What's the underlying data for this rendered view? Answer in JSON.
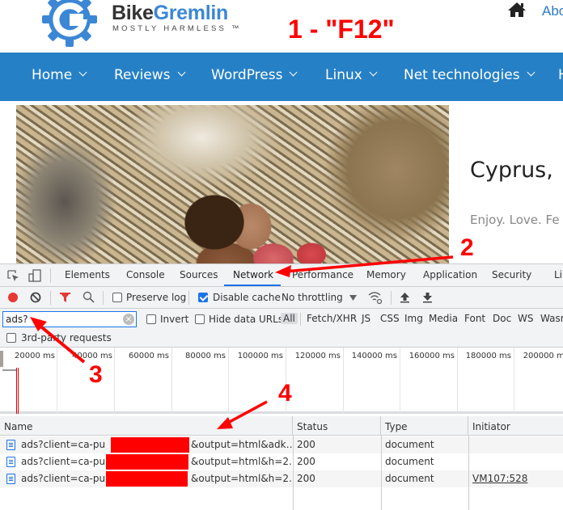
{
  "site": {
    "logo_brand_part1": "Bike",
    "logo_brand_part2": "Gremlin",
    "logo_tagline": "MOSTLY HARMLESS ™",
    "top_link": "About",
    "nav": [
      {
        "label": "Home"
      },
      {
        "label": "Reviews"
      },
      {
        "label": "WordPress"
      },
      {
        "label": "Linux"
      },
      {
        "label": "Net technologies"
      },
      {
        "label": "H"
      }
    ],
    "post_title": "Cyprus,",
    "post_tagline": "Enjoy. Love. Fe"
  },
  "annotations": {
    "step1": "1 - \"F12\"",
    "step2": "2",
    "step3": "3",
    "step4": "4",
    "color": "#ff0000"
  },
  "devtools": {
    "tabs": [
      {
        "label": "Elements"
      },
      {
        "label": "Console"
      },
      {
        "label": "Sources"
      },
      {
        "label": "Network",
        "active": true
      },
      {
        "label": "Performance"
      },
      {
        "label": "Memory"
      },
      {
        "label": "Application"
      },
      {
        "label": "Security"
      },
      {
        "label": "Li"
      }
    ],
    "toolbar": {
      "preserve_log": {
        "label": "Preserve log",
        "checked": false
      },
      "disable_cache": {
        "label": "Disable cache",
        "checked": true
      },
      "throttling": "No throttling"
    },
    "filter": {
      "value": "ads?",
      "invert": {
        "label": "Invert",
        "checked": false
      },
      "hide_data_urls": {
        "label": "Hide data URLs",
        "checked": false
      },
      "types": [
        "All",
        "Fetch/XHR",
        "JS",
        "CSS",
        "Img",
        "Media",
        "Font",
        "Doc",
        "WS",
        "Wasm"
      ],
      "active_type": "All",
      "third_party": {
        "label": "3rd-party requests",
        "checked": false
      }
    },
    "timeline_ticks": [
      "20000 ms",
      "40000 ms",
      "60000 ms",
      "80000 ms",
      "100000 ms",
      "120000 ms",
      "140000 ms",
      "160000 ms",
      "180000 ms",
      "200000 ms"
    ],
    "table": {
      "headers": {
        "name": "Name",
        "status": "Status",
        "type": "Type",
        "initiator": "Initiator"
      },
      "rows": [
        {
          "name_prefix": "ads?client=ca-pub-",
          "name_suffix": "&output=html&adk…",
          "status": "200",
          "type": "document",
          "initiator": ""
        },
        {
          "name_prefix": "ads?client=ca-pub-6",
          "name_suffix": "&output=html&h=2…",
          "status": "200",
          "type": "document",
          "initiator": ""
        },
        {
          "name_prefix": "ads?client=ca-pub-6",
          "name_suffix": "&output=html&h=2…",
          "status": "200",
          "type": "document",
          "initiator": "VM107:528"
        }
      ]
    }
  }
}
